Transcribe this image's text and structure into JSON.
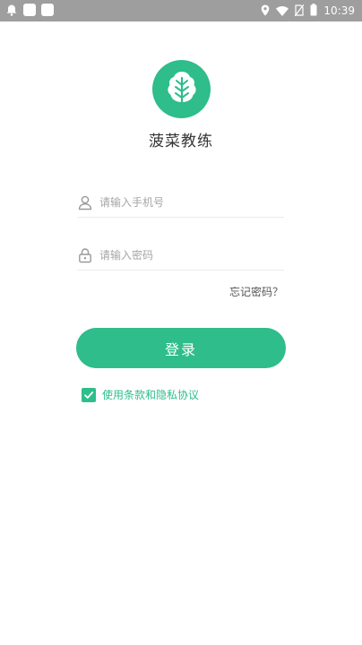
{
  "status_bar": {
    "time": "10:39",
    "left_icons": [
      "notification-bell-icon",
      "app-square-icon",
      "app-square-icon"
    ],
    "right_icons": [
      "location-icon",
      "wifi-icon",
      "no-sim-icon",
      "battery-icon"
    ]
  },
  "app": {
    "name": "菠菜教练",
    "logo_icon": "spinach-leaf-icon",
    "brand_color": "#2ebd8b"
  },
  "login_form": {
    "phone": {
      "placeholder": "请输入手机号",
      "value": "",
      "icon": "user-icon"
    },
    "password": {
      "placeholder": "请输入密码",
      "value": "",
      "icon": "lock-icon"
    },
    "forgot_password_label": "忘记密码？",
    "login_button_label": "登录",
    "agreement": {
      "checked": true,
      "label": "使用条款和隐私协议"
    }
  }
}
